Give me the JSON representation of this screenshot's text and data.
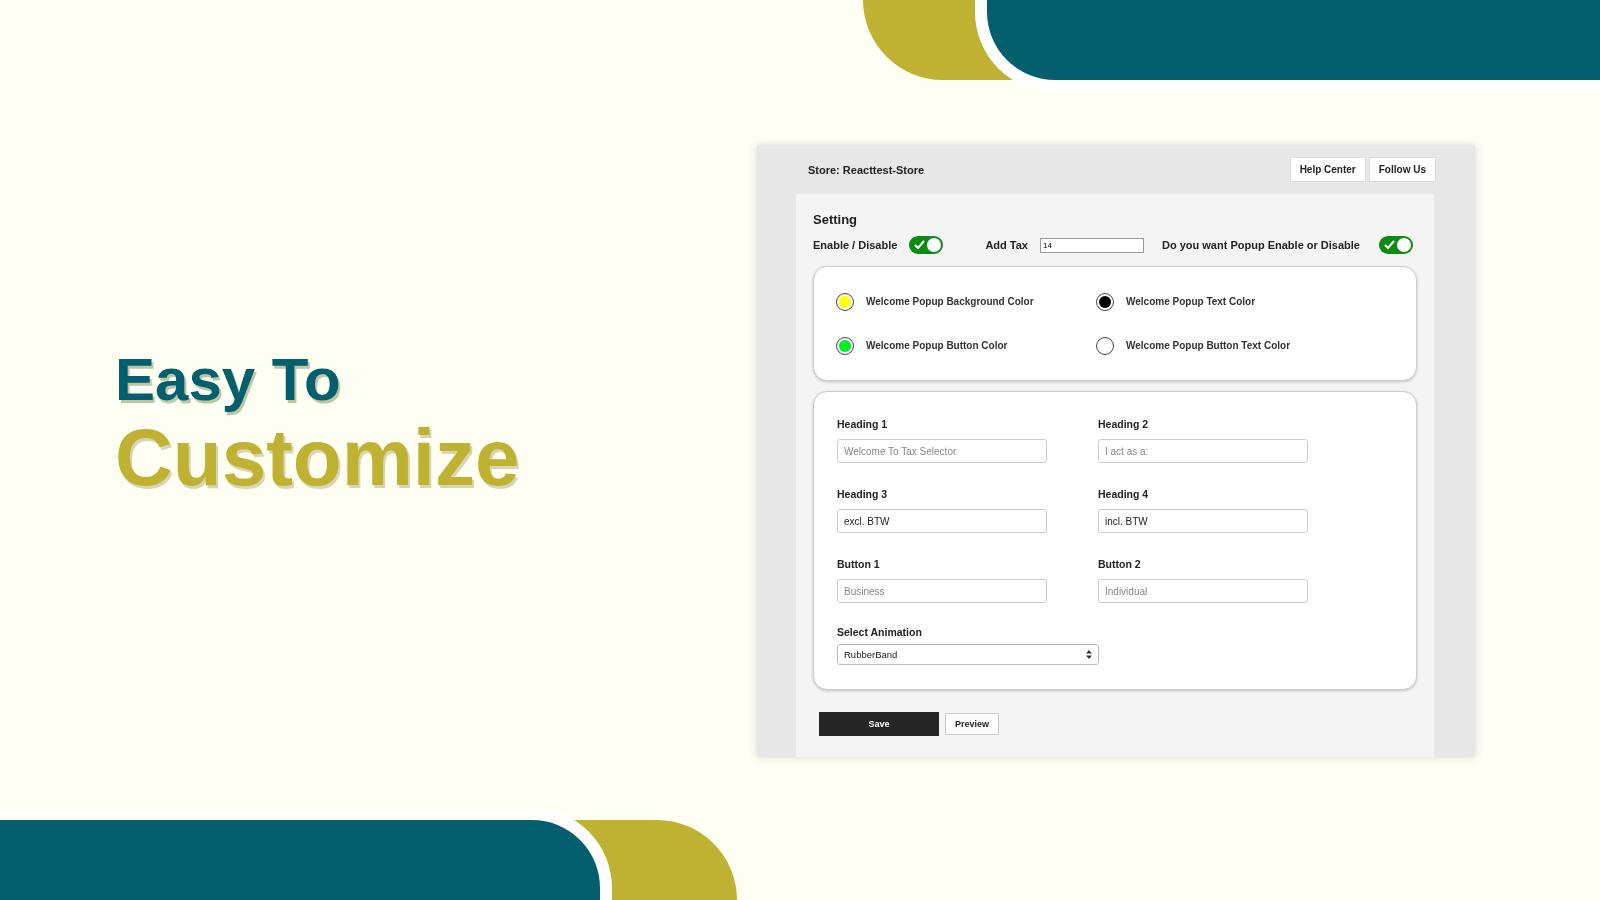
{
  "headline": {
    "line_1": "Easy To",
    "line_2": "Customize"
  },
  "app": {
    "store_label": "Store: Reacttest-Store",
    "header_buttons": [
      "Help Center",
      "Follow Us"
    ],
    "section_title": "Setting",
    "enable_toggle": {
      "label": "Enable / Disable",
      "on": true
    },
    "tax": {
      "label": "Add Tax",
      "value": "14"
    },
    "popup_toggle": {
      "label": "Do you want Popup Enable or Disable",
      "on": true
    },
    "color_options": [
      {
        "label": "Welcome Popup Background Color",
        "color": "#ffff00"
      },
      {
        "label": "Welcome Popup Text Color",
        "color": "#000000"
      },
      {
        "label": "Welcome Popup Button Color",
        "color": "#00ee22"
      },
      {
        "label": "Welcome Popup Button Text Color",
        "color": "#ffffff"
      }
    ],
    "fields": [
      {
        "label": "Heading 1",
        "placeholder": "Welcome To Tax Selector"
      },
      {
        "label": "Heading 2",
        "placeholder": "I act as a:"
      },
      {
        "label": "Heading 3",
        "value": "excl. BTW"
      },
      {
        "label": "Heading 4",
        "value": "incl. BTW"
      },
      {
        "label": "Button 1",
        "placeholder": "Business"
      },
      {
        "label": "Button 2",
        "placeholder": "Individual"
      }
    ],
    "animation": {
      "label": "Select Animation",
      "value": "RubberBand"
    },
    "actions": [
      {
        "label": "Save",
        "kind": "primary"
      },
      {
        "label": "Preview",
        "kind": "secondary"
      }
    ]
  }
}
